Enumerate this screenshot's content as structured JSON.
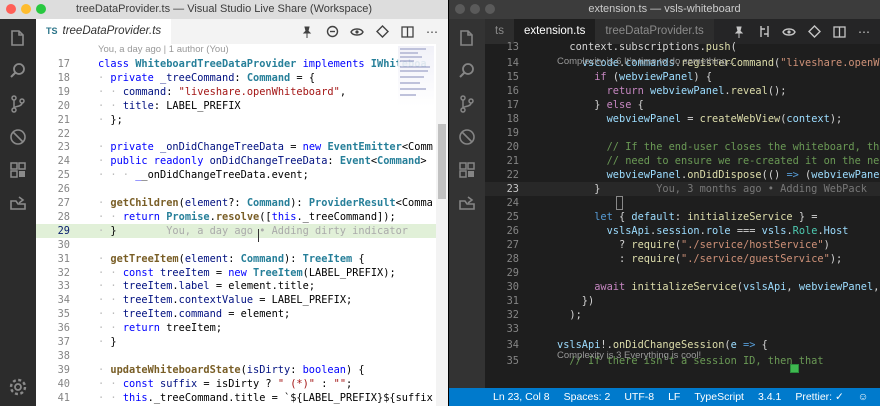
{
  "left": {
    "window_title": "treeDataProvider.ts — Visual Studio Live Share (Workspace)",
    "tab": {
      "badge": "TS",
      "label": "treeDataProvider.ts",
      "close": "×"
    },
    "blame_header": "You, a day ago | 1 author (You)",
    "lines": [
      {
        "n": "17",
        "tokens": [
          [
            "kw",
            "class "
          ],
          [
            "ty",
            "WhiteboardTreeDataProvider "
          ],
          [
            "kw",
            "implements "
          ],
          [
            "ty",
            "IWhiteboa"
          ]
        ]
      },
      {
        "n": "18",
        "tokens": [
          [
            "ws",
            "· "
          ],
          [
            "kw",
            "private "
          ],
          [
            "id",
            "_treeCommand"
          ],
          [
            "tx",
            ": "
          ],
          [
            "ty",
            "Command"
          ],
          [
            "tx",
            " = {"
          ]
        ]
      },
      {
        "n": "19",
        "tokens": [
          [
            "ws",
            "· · "
          ],
          [
            "id",
            "command"
          ],
          [
            "tx",
            ": "
          ],
          [
            "st",
            "\"liveshare.openWhiteboard\""
          ],
          [
            "tx",
            ","
          ]
        ]
      },
      {
        "n": "20",
        "tokens": [
          [
            "ws",
            "· · "
          ],
          [
            "id",
            "title"
          ],
          [
            "tx",
            ": LABEL_PREFIX"
          ]
        ]
      },
      {
        "n": "21",
        "tokens": [
          [
            "ws",
            "· "
          ],
          [
            "tx",
            "};"
          ]
        ]
      },
      {
        "n": "22",
        "tokens": []
      },
      {
        "n": "23",
        "tokens": [
          [
            "ws",
            "· "
          ],
          [
            "kw",
            "private "
          ],
          [
            "id",
            "_onDidChangeTreeData"
          ],
          [
            "tx",
            " = "
          ],
          [
            "kw",
            "new "
          ],
          [
            "ty",
            "EventEmitter"
          ],
          [
            "tx",
            "<Comm"
          ]
        ]
      },
      {
        "n": "24",
        "tokens": [
          [
            "ws",
            "· "
          ],
          [
            "kw",
            "public readonly "
          ],
          [
            "id",
            "onDidChangeTreeData"
          ],
          [
            "tx",
            ": "
          ],
          [
            "ty",
            "Event"
          ],
          [
            "tx",
            "<"
          ],
          [
            "ty",
            "Command"
          ],
          [
            "tx",
            ">"
          ]
        ]
      },
      {
        "n": "25",
        "tokens": [
          [
            "ws",
            "· · · "
          ],
          [
            "kw",
            "_"
          ],
          [
            "tx",
            "_onDidChangeTreeData.event;"
          ]
        ]
      },
      {
        "n": "26",
        "tokens": []
      },
      {
        "n": "27",
        "tokens": [
          [
            "ws",
            "· "
          ],
          [
            "fn",
            "getChildren"
          ],
          [
            "tx",
            "("
          ],
          [
            "id",
            "element"
          ],
          [
            "tx",
            "?: "
          ],
          [
            "ty",
            "Command"
          ],
          [
            "tx",
            "): "
          ],
          [
            "ty",
            "ProviderResult"
          ],
          [
            "tx",
            "<Comma"
          ]
        ]
      },
      {
        "n": "28",
        "tokens": [
          [
            "ws",
            "· · "
          ],
          [
            "kw",
            "return "
          ],
          [
            "ty",
            "Promise"
          ],
          [
            "tx",
            "."
          ],
          [
            "fn",
            "resolve"
          ],
          [
            "tx",
            "(["
          ],
          [
            "kw",
            "this"
          ],
          [
            "tx",
            "._treeCommand]);"
          ]
        ]
      },
      {
        "n": "29",
        "tokens": [
          [
            "ws",
            "· "
          ],
          [
            "tx",
            "}"
          ],
          [
            "blame",
            "        You, a day ago • Adding dirty indicator"
          ]
        ]
      },
      {
        "n": "30",
        "tokens": []
      },
      {
        "n": "31",
        "tokens": [
          [
            "ws",
            "· "
          ],
          [
            "fn",
            "getTreeItem"
          ],
          [
            "tx",
            "("
          ],
          [
            "id",
            "element"
          ],
          [
            "tx",
            ": "
          ],
          [
            "ty",
            "Command"
          ],
          [
            "tx",
            "): "
          ],
          [
            "ty",
            "TreeItem"
          ],
          [
            "tx",
            " {"
          ]
        ]
      },
      {
        "n": "32",
        "tokens": [
          [
            "ws",
            "· · "
          ],
          [
            "kw",
            "const "
          ],
          [
            "id",
            "treeItem"
          ],
          [
            "tx",
            " = "
          ],
          [
            "kw",
            "new "
          ],
          [
            "ty",
            "TreeItem"
          ],
          [
            "tx",
            "(LABEL_PREFIX);"
          ]
        ]
      },
      {
        "n": "33",
        "tokens": [
          [
            "ws",
            "· · "
          ],
          [
            "id",
            "treeItem"
          ],
          [
            "tx",
            "."
          ],
          [
            "id",
            "label"
          ],
          [
            "tx",
            " = element.title;"
          ]
        ]
      },
      {
        "n": "34",
        "tokens": [
          [
            "ws",
            "· · "
          ],
          [
            "id",
            "treeItem"
          ],
          [
            "tx",
            "."
          ],
          [
            "id",
            "contextValue"
          ],
          [
            "tx",
            " = LABEL_PREFIX;"
          ]
        ]
      },
      {
        "n": "35",
        "tokens": [
          [
            "ws",
            "· · "
          ],
          [
            "id",
            "treeItem"
          ],
          [
            "tx",
            "."
          ],
          [
            "id",
            "command"
          ],
          [
            "tx",
            " = element;"
          ]
        ]
      },
      {
        "n": "36",
        "tokens": [
          [
            "ws",
            "· · "
          ],
          [
            "kw",
            "return "
          ],
          [
            "tx",
            "treeItem;"
          ]
        ]
      },
      {
        "n": "37",
        "tokens": [
          [
            "ws",
            "· "
          ],
          [
            "tx",
            "}"
          ]
        ]
      },
      {
        "n": "38",
        "tokens": []
      },
      {
        "n": "39",
        "tokens": [
          [
            "ws",
            "· "
          ],
          [
            "fn",
            "updateWhiteboardState"
          ],
          [
            "tx",
            "("
          ],
          [
            "id",
            "isDirty"
          ],
          [
            "tx",
            ": "
          ],
          [
            "kw",
            "boolean"
          ],
          [
            "tx",
            ") {"
          ]
        ]
      },
      {
        "n": "40",
        "tokens": [
          [
            "ws",
            "· · "
          ],
          [
            "kw",
            "const "
          ],
          [
            "id",
            "suffix"
          ],
          [
            "tx",
            " = isDirty ? "
          ],
          [
            "st",
            "\" (*)\""
          ],
          [
            "tx",
            " : "
          ],
          [
            "st",
            "\"\""
          ],
          [
            "tx",
            ";"
          ]
        ]
      },
      {
        "n": "41",
        "tokens": [
          [
            "ws",
            "· · "
          ],
          [
            "kw",
            "this"
          ],
          [
            "tx",
            "._treeCommand.title = `${LABEL_PREFIX}${suffix"
          ]
        ]
      }
    ]
  },
  "right": {
    "window_title": "extension.ts — vsls-whiteboard",
    "tabs": [
      {
        "badge": "",
        "label": "ts",
        "active": false
      },
      {
        "badge": "TS",
        "label": "extension.ts",
        "active": true
      },
      {
        "badge": "TS",
        "label": "treeDataProvider.ts",
        "active": false
      }
    ],
    "lens_top": "Complexity is 6 It's time to do something...",
    "lens_bottom": "Complexity is 3 Everything is cool!",
    "lines": [
      {
        "n": "13",
        "tokens": [
          [
            "tx",
            "  context.subscriptions."
          ],
          [
            "fn",
            "push"
          ],
          [
            "tx",
            "("
          ]
        ]
      },
      {
        "n": "14",
        "tokens": [
          [
            "tx",
            "    "
          ],
          [
            "id",
            "vscode"
          ],
          [
            "tx",
            "."
          ],
          [
            "id",
            "commands"
          ],
          [
            "tx",
            "."
          ],
          [
            "fn",
            "registerCommand"
          ],
          [
            "tx",
            "("
          ],
          [
            "st",
            "\"liveshare.openWhiteboa"
          ]
        ]
      },
      {
        "n": "15",
        "tokens": [
          [
            "tx",
            "      "
          ],
          [
            "kw2",
            "if "
          ],
          [
            "tx",
            "("
          ],
          [
            "id",
            "webviewPanel"
          ],
          [
            "tx",
            ") {"
          ]
        ]
      },
      {
        "n": "16",
        "tokens": [
          [
            "tx",
            "        "
          ],
          [
            "kw2",
            "return "
          ],
          [
            "id",
            "webviewPanel"
          ],
          [
            "tx",
            "."
          ],
          [
            "fn",
            "reveal"
          ],
          [
            "tx",
            "();"
          ]
        ]
      },
      {
        "n": "17",
        "tokens": [
          [
            "tx",
            "      } "
          ],
          [
            "kw2",
            "else "
          ],
          [
            "tx",
            "{"
          ]
        ]
      },
      {
        "n": "18",
        "tokens": [
          [
            "tx",
            "        "
          ],
          [
            "id",
            "webviewPanel"
          ],
          [
            "tx",
            " = "
          ],
          [
            "fn",
            "createWebView"
          ],
          [
            "tx",
            "("
          ],
          [
            "id",
            "context"
          ],
          [
            "tx",
            ");"
          ]
        ]
      },
      {
        "n": "19",
        "tokens": []
      },
      {
        "n": "20",
        "tokens": [
          [
            "cm",
            "        // If the end-user closes the whiteboard, then we"
          ]
        ]
      },
      {
        "n": "21",
        "tokens": [
          [
            "cm",
            "        // need to ensure we re-created it on the next clic"
          ]
        ]
      },
      {
        "n": "22",
        "tokens": [
          [
            "tx",
            "        "
          ],
          [
            "id",
            "webviewPanel"
          ],
          [
            "tx",
            "."
          ],
          [
            "fn",
            "onDidDispose"
          ],
          [
            "tx",
            "(() "
          ],
          [
            "kw",
            "=> "
          ],
          [
            "tx",
            "("
          ],
          [
            "id",
            "webviewPanel"
          ],
          [
            "tx",
            " = "
          ],
          [
            "kw",
            "nu"
          ]
        ]
      },
      {
        "n": "23",
        "tokens": [
          [
            "tx",
            "      }"
          ],
          [
            "blame",
            "         You, 3 months ago • Adding WebPack"
          ]
        ]
      },
      {
        "n": "24",
        "tokens": []
      },
      {
        "n": "25",
        "tokens": [
          [
            "tx",
            "      "
          ],
          [
            "kw",
            "let "
          ],
          [
            "tx",
            "{ "
          ],
          [
            "id",
            "default"
          ],
          [
            "tx",
            ": "
          ],
          [
            "fn",
            "initializeService"
          ],
          [
            "tx",
            " } ="
          ]
        ]
      },
      {
        "n": "26",
        "tokens": [
          [
            "tx",
            "        "
          ],
          [
            "id",
            "vslsApi"
          ],
          [
            "tx",
            "."
          ],
          [
            "id",
            "session"
          ],
          [
            "tx",
            "."
          ],
          [
            "id",
            "role"
          ],
          [
            "tx",
            " === "
          ],
          [
            "id",
            "vsls"
          ],
          [
            "tx",
            "."
          ],
          [
            "ty",
            "Role"
          ],
          [
            "tx",
            "."
          ],
          [
            "id",
            "Host"
          ]
        ]
      },
      {
        "n": "27",
        "tokens": [
          [
            "tx",
            "          ? "
          ],
          [
            "fn",
            "require"
          ],
          [
            "tx",
            "("
          ],
          [
            "st",
            "\"./service/hostService\""
          ],
          [
            "tx",
            ")"
          ]
        ]
      },
      {
        "n": "28",
        "tokens": [
          [
            "tx",
            "          : "
          ],
          [
            "fn",
            "require"
          ],
          [
            "tx",
            "("
          ],
          [
            "st",
            "\"./service/guestService\""
          ],
          [
            "tx",
            ");"
          ]
        ]
      },
      {
        "n": "29",
        "tokens": []
      },
      {
        "n": "30",
        "tokens": [
          [
            "tx",
            "      "
          ],
          [
            "kw2",
            "await "
          ],
          [
            "fn",
            "initializeService"
          ],
          [
            "tx",
            "("
          ],
          [
            "id",
            "vslsApi"
          ],
          [
            "tx",
            ", "
          ],
          [
            "id",
            "webviewPanel"
          ],
          [
            "tx",
            ", "
          ],
          [
            "id",
            "treeDat"
          ]
        ]
      },
      {
        "n": "31",
        "tokens": [
          [
            "tx",
            "    })"
          ]
        ]
      },
      {
        "n": "32",
        "tokens": [
          [
            "tx",
            "  );"
          ]
        ]
      },
      {
        "n": "33",
        "tokens": []
      },
      {
        "n": "34",
        "tokens": [
          [
            "id",
            "vslsApi"
          ],
          [
            "tx",
            "!."
          ],
          [
            "fn",
            "onDidChangeSession"
          ],
          [
            "tx",
            "("
          ],
          [
            "id",
            "e"
          ],
          [
            "tx",
            " "
          ],
          [
            "kw",
            "=> "
          ],
          [
            "tx",
            "{ "
          ]
        ]
      },
      {
        "n": "35",
        "tokens": [
          [
            "cm",
            "  // If there isn't a session ID, then that"
          ]
        ]
      }
    ],
    "status": {
      "position": "Ln 23, Col 8",
      "spaces": "Spaces: 2",
      "encoding": "UTF-8",
      "eol": "LF",
      "language": "TypeScript",
      "version": "3.4.1",
      "prettier": "Prettier: ✓",
      "bell_count": "1"
    }
  }
}
